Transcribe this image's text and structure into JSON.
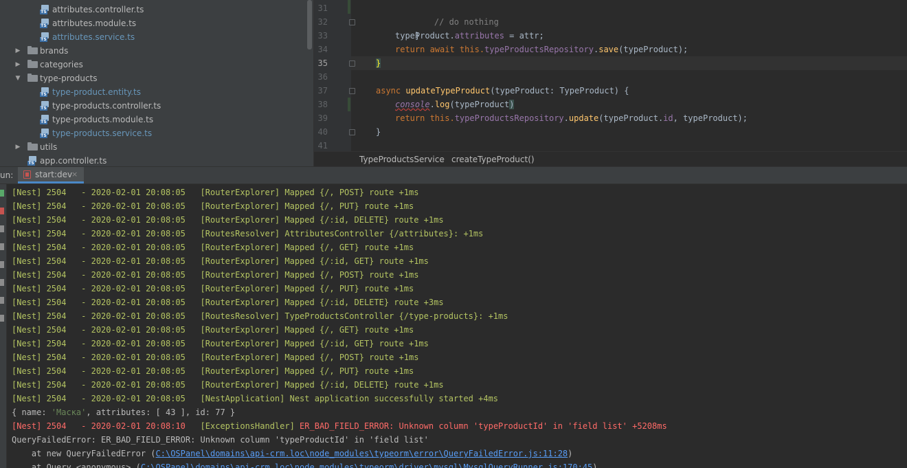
{
  "project_tree": {
    "items": [
      {
        "label": "attributes.controller.ts",
        "kind": "ts",
        "modified": false,
        "expandable": false
      },
      {
        "label": "attributes.module.ts",
        "kind": "ts",
        "modified": false,
        "expandable": false
      },
      {
        "label": "attributes.service.ts",
        "kind": "ts",
        "modified": true,
        "expandable": false
      },
      {
        "label": "brands",
        "kind": "folder",
        "modified": false,
        "expandable": true,
        "expanded": false
      },
      {
        "label": "categories",
        "kind": "folder",
        "modified": false,
        "expandable": true,
        "expanded": false
      },
      {
        "label": "type-products",
        "kind": "folder",
        "modified": false,
        "expandable": true,
        "expanded": true
      },
      {
        "label": "type-product.entity.ts",
        "kind": "ts",
        "modified": true,
        "expandable": false
      },
      {
        "label": "type-products.controller.ts",
        "kind": "ts",
        "modified": false,
        "expandable": false
      },
      {
        "label": "type-products.module.ts",
        "kind": "ts",
        "modified": false,
        "expandable": false
      },
      {
        "label": "type-products.service.ts",
        "kind": "ts",
        "modified": true,
        "expandable": false
      },
      {
        "label": "utils",
        "kind": "folder",
        "modified": false,
        "expandable": true,
        "expanded": false
      },
      {
        "label": "app.controller.ts",
        "kind": "ts",
        "modified": false,
        "expandable": false
      }
    ],
    "ts_badge": "TS"
  },
  "editor": {
    "line_numbers": [
      "31",
      "32",
      "33",
      "34",
      "35",
      "36",
      "37",
      "38",
      "39",
      "40",
      "41"
    ],
    "lines": {
      "l31": "// do nothing",
      "l32": "}",
      "l33_a": "typeProduct.",
      "l33_b": "attributes",
      "l33_c": " = attr;",
      "l34_a": "return await this.",
      "l34_b": "typeProductsRepository",
      "l34_c": ".",
      "l34_d": "save",
      "l34_e": "(typeProduct);",
      "l35": "}",
      "l37_a": "async ",
      "l37_b": "updateTypeProduct",
      "l37_c": "(typeProduct: TypeProduct) {",
      "l38_a": "console",
      "l38_b": ".",
      "l38_c": "log",
      "l38_d": "(typeProduct",
      "l38_e": ")",
      "l39_a": "return this.",
      "l39_b": "typeProductsRepository",
      "l39_c": ".",
      "l39_d": "update",
      "l39_e": "(typeProduct.",
      "l39_f": "id",
      "l39_g": ", typeProduct);",
      "l40": "}"
    },
    "breadcrumbs": [
      "TypeProductsService",
      "createTypeProduct()"
    ],
    "breadcrumb_separator": "›"
  },
  "run": {
    "label": "un:",
    "tab_label": "start:dev",
    "close_glyph": "×"
  },
  "console": {
    "log_lines": [
      {
        "prefix": "[Nest] 2504   - 2020-02-01 20:08:05   ",
        "tag": "[RouterExplorer]",
        "msg": " Mapped {/, POST} route +1ms"
      },
      {
        "prefix": "[Nest] 2504   - 2020-02-01 20:08:05   ",
        "tag": "[RouterExplorer]",
        "msg": " Mapped {/, PUT} route +1ms"
      },
      {
        "prefix": "[Nest] 2504   - 2020-02-01 20:08:05   ",
        "tag": "[RouterExplorer]",
        "msg": " Mapped {/:id, DELETE} route +1ms"
      },
      {
        "prefix": "[Nest] 2504   - 2020-02-01 20:08:05   ",
        "tag": "[RoutesResolver]",
        "msg": " AttributesController {/attributes}: +1ms"
      },
      {
        "prefix": "[Nest] 2504   - 2020-02-01 20:08:05   ",
        "tag": "[RouterExplorer]",
        "msg": " Mapped {/, GET} route +1ms"
      },
      {
        "prefix": "[Nest] 2504   - 2020-02-01 20:08:05   ",
        "tag": "[RouterExplorer]",
        "msg": " Mapped {/:id, GET} route +1ms"
      },
      {
        "prefix": "[Nest] 2504   - 2020-02-01 20:08:05   ",
        "tag": "[RouterExplorer]",
        "msg": " Mapped {/, POST} route +1ms"
      },
      {
        "prefix": "[Nest] 2504   - 2020-02-01 20:08:05   ",
        "tag": "[RouterExplorer]",
        "msg": " Mapped {/, PUT} route +1ms"
      },
      {
        "prefix": "[Nest] 2504   - 2020-02-01 20:08:05   ",
        "tag": "[RouterExplorer]",
        "msg": " Mapped {/:id, DELETE} route +3ms"
      },
      {
        "prefix": "[Nest] 2504   - 2020-02-01 20:08:05   ",
        "tag": "[RoutesResolver]",
        "msg": " TypeProductsController {/type-products}: +1ms"
      },
      {
        "prefix": "[Nest] 2504   - 2020-02-01 20:08:05   ",
        "tag": "[RouterExplorer]",
        "msg": " Mapped {/, GET} route +1ms"
      },
      {
        "prefix": "[Nest] 2504   - 2020-02-01 20:08:05   ",
        "tag": "[RouterExplorer]",
        "msg": " Mapped {/:id, GET} route +1ms"
      },
      {
        "prefix": "[Nest] 2504   - 2020-02-01 20:08:05   ",
        "tag": "[RouterExplorer]",
        "msg": " Mapped {/, POST} route +1ms"
      },
      {
        "prefix": "[Nest] 2504   - 2020-02-01 20:08:05   ",
        "tag": "[RouterExplorer]",
        "msg": " Mapped {/, PUT} route +1ms"
      },
      {
        "prefix": "[Nest] 2504   - 2020-02-01 20:08:05   ",
        "tag": "[RouterExplorer]",
        "msg": " Mapped {/:id, DELETE} route +1ms"
      },
      {
        "prefix": "[Nest] 2504   - 2020-02-01 20:08:05   ",
        "tag": "[NestApplication]",
        "msg": " Nest application successfully started +4ms"
      }
    ],
    "object_line": {
      "a": "{ name: ",
      "b": "'Маска'",
      "c": ", attributes: [ ",
      "d": "43",
      "e": " ], id: ",
      "f": "77",
      "g": " }"
    },
    "error_line": {
      "prefix": "[Nest] 2504   - 2020-02-01 20:08:10   ",
      "tag": "[ExceptionsHandler]",
      "msg": " ER_BAD_FIELD_ERROR: Unknown column 'typeProductId' in 'field list' +5208ms"
    },
    "query_error": "QueryFailedError: ER_BAD_FIELD_ERROR: Unknown column 'typeProductId' in 'field list'",
    "stack_1": {
      "prefix": "    at new QueryFailedError (",
      "link": "C:\\OSPanel\\domains\\api-crm.loc\\node_modules\\typeorm\\error\\QueryFailedError.js:11:28",
      "suffix": ")"
    },
    "stack_2": {
      "prefix": "    at Query.<anonymous> (",
      "link": "C:\\OSPanel\\domains\\api-crm.loc\\node_modules\\typeorm\\driver\\mysql\\MysqlQueryRunner.js:170:45",
      "suffix": ")"
    }
  },
  "colors": {
    "log_green": "#b4c462",
    "error_red": "#ff6b68",
    "link_blue": "#589df6",
    "keyword_orange": "#cc7832",
    "function_yellow": "#ffc66d"
  }
}
